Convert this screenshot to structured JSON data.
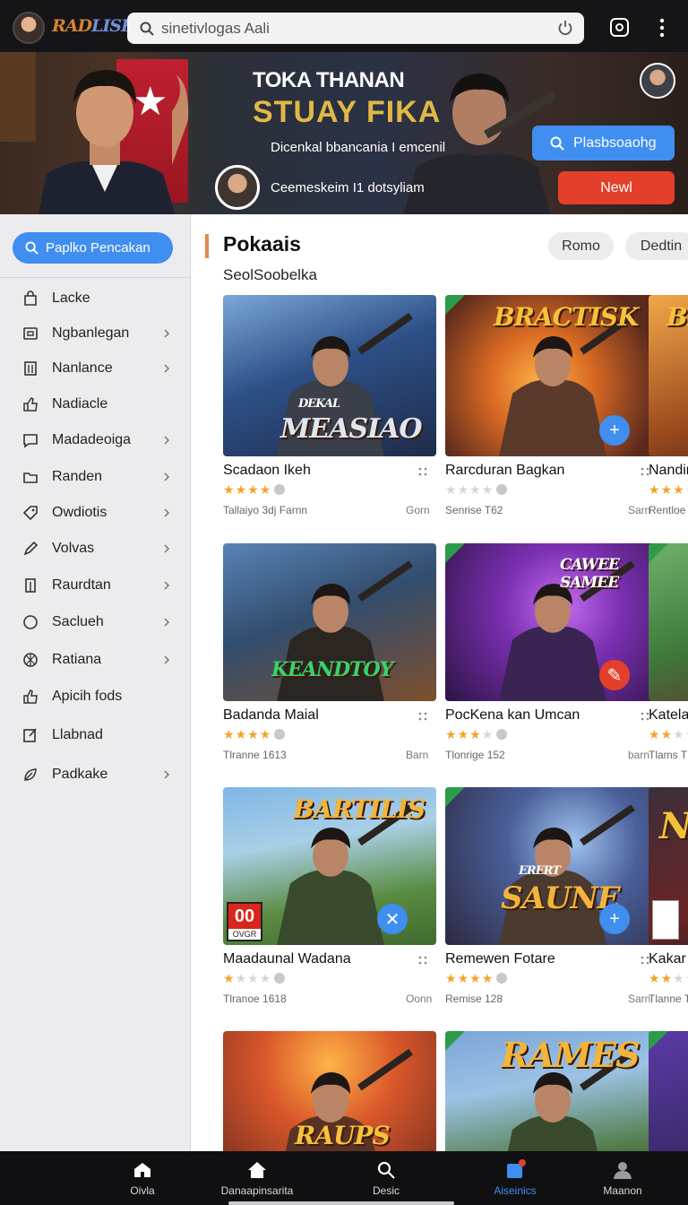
{
  "topbar": {
    "logo_part1": "RAD",
    "logo_part2": "LISK",
    "search_value": "sinetivlogas Aali",
    "search_placeholder": "sinetivlogas Aali",
    "icons": [
      "avatar",
      "search-icon",
      "power-icon",
      "instagram-icon",
      "more-vertical-icon"
    ]
  },
  "hero": {
    "title_line1": "TOKA THANAN",
    "title_line2": "STUAY FIKA",
    "subtitle": "Dicenkal bbancania I emcenil",
    "subtitle2": "Ceemeskeim I1 dotsyliam",
    "button_primary": "Plasbsoaohg",
    "button_secondary": "Newl",
    "accent_colors": {
      "primary": "#3f8ef0",
      "secondary": "#e3402c",
      "title": "#e2b845"
    }
  },
  "sidebar": {
    "search_button": "Paplko Pencakan",
    "items": [
      {
        "label": "Lacke",
        "icon": "bag-icon",
        "chevron": false
      },
      {
        "label": "Ngbanlegan",
        "icon": "tv-icon",
        "chevron": true
      },
      {
        "label": "Nanlance",
        "icon": "column-icon",
        "chevron": true
      },
      {
        "label": "Nadiacle",
        "icon": "thumb-icon",
        "chevron": false
      },
      {
        "label": "Madadeoiga",
        "icon": "chat-icon",
        "chevron": true
      },
      {
        "label": "Randen",
        "icon": "folder-icon",
        "chevron": true
      },
      {
        "label": "Owdiotis",
        "icon": "tag-icon",
        "chevron": true
      },
      {
        "label": "Volvas",
        "icon": "pencil-icon",
        "chevron": true
      },
      {
        "label": "Raurdtan",
        "icon": "building-icon",
        "chevron": true
      },
      {
        "label": "Saclueh",
        "icon": "circle-icon",
        "chevron": true
      },
      {
        "label": "Ratiana",
        "icon": "ball-icon",
        "chevron": true
      },
      {
        "label": "Apicih fods",
        "icon": "thumb-up-icon",
        "chevron": false
      },
      {
        "label": "Llabnad",
        "icon": "edit-box-icon",
        "chevron": false
      },
      {
        "label": "Padkake",
        "icon": "leaf-icon",
        "chevron": true
      }
    ]
  },
  "content": {
    "section_title": "Pokaais",
    "section_subtitle": "SeolSoobelka",
    "chips": [
      "Romo",
      "Dedtin"
    ],
    "cards": [
      {
        "name": "Scadaon Ikeh",
        "stars": 4,
        "meta": "Tallaiyo 3dj Farnn",
        "side": "Gorn",
        "art_title": "MEASIAO",
        "art_pre": "DEKAL",
        "fab": null
      },
      {
        "name": "Rarcduran Bagkan",
        "stars": 0,
        "meta": "Senrise T62",
        "side": "Sarn",
        "art_title": "BRACTISK",
        "art_pre": "",
        "fab": "+"
      },
      {
        "name": "Nandin",
        "stars": 3,
        "meta": "Rentloe",
        "side": "",
        "art_title": "BR",
        "art_pre": "",
        "fab": null
      },
      {
        "name": "Badanda Maial",
        "stars": 4,
        "meta": "Tlranne 1613",
        "side": "Barn",
        "art_title": "KEANDTOY",
        "art_pre": "",
        "fab": null
      },
      {
        "name": "PocKena kan Umcan",
        "stars": 3,
        "meta": "Tlonrige 152",
        "side": "barn",
        "art_title": "CAWEE SAMEE",
        "art_pre": "",
        "fab": "✎"
      },
      {
        "name": "Katela",
        "stars": 2,
        "meta": "Tlams T",
        "side": "",
        "art_title": "",
        "art_pre": "",
        "fab": null
      },
      {
        "name": "Maadaunal Wadana",
        "stars": 1,
        "meta": "Tlranoe 1618",
        "side": "Oonn",
        "art_title": "BARTILIS",
        "art_pre": "",
        "fab": "✕"
      },
      {
        "name": "Remewen Fotare",
        "stars": 4,
        "meta": "Remise 128",
        "side": "Sarn",
        "art_title": "SAUNE",
        "art_pre": "ERERT",
        "fab": "+"
      },
      {
        "name": "Kakar",
        "stars": 2,
        "meta": "Tlanne T",
        "side": "",
        "art_title": "N",
        "art_pre": "",
        "fab": null
      },
      {
        "name": "",
        "stars": 0,
        "meta": "",
        "side": "",
        "art_title": "RAUPS",
        "art_pre": "",
        "fab": null
      },
      {
        "name": "",
        "stars": 0,
        "meta": "",
        "side": "",
        "art_title": "RAMES",
        "art_pre": "",
        "fab": null
      },
      {
        "name": "",
        "stars": 0,
        "meta": "",
        "side": "",
        "art_title": "",
        "art_pre": "",
        "fab": null
      }
    ],
    "badge_text": "00",
    "badge_sub": "OVGR"
  },
  "bottomnav": {
    "items": [
      {
        "label": "Oivla",
        "icon": "home-icon",
        "active": false
      },
      {
        "label": "Danaapinsarita",
        "icon": "house-icon",
        "active": false
      },
      {
        "label": "Desic",
        "icon": "search-icon",
        "active": false
      },
      {
        "label": "Aiseinics",
        "icon": "games-icon",
        "active": true
      },
      {
        "label": "Maanon",
        "icon": "profile-icon",
        "active": false
      }
    ]
  }
}
